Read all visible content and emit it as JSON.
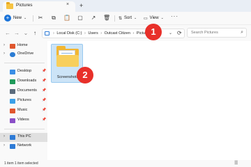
{
  "window": {
    "tab_title": "Pictures",
    "tab_close": "×",
    "new_tab": "+"
  },
  "toolbar": {
    "new_label": "New",
    "new_plus": "+",
    "sort_label": "Sort",
    "view_label": "View",
    "more_label": "···",
    "chevron": "⌄",
    "icons": {
      "cut": "✂",
      "copy": "⧉",
      "paste": "📋",
      "rename": "▢",
      "share": "↗",
      "delete": "🗑",
      "sort": "⇅",
      "view": "▭"
    }
  },
  "navigation": {
    "back": "←",
    "forward": "→",
    "recent": "⌄",
    "up": "↑"
  },
  "address": {
    "crumbs": [
      "Local Disk (C:)",
      "Users",
      "Outcast Citizen",
      "Pictures"
    ],
    "separator": "›",
    "dropdown": "⌄",
    "refresh": "⟳"
  },
  "search": {
    "placeholder": "Search Pictures",
    "icon": "⌕"
  },
  "sidebar": {
    "items": [
      {
        "label": "Home",
        "icon": "home-icon",
        "color": "#e0572e"
      },
      {
        "label": "OneDrive",
        "icon": "onedrive-icon",
        "color": "#2b7cd3"
      },
      {
        "label": "Desktop",
        "icon": "desktop-icon",
        "color": "#3a8ee6"
      },
      {
        "label": "Downloads",
        "icon": "downloads-icon",
        "color": "#1f9a5a"
      },
      {
        "label": "Documents",
        "icon": "documents-icon",
        "color": "#5a6b7c"
      },
      {
        "label": "Pictures",
        "icon": "pictures-icon",
        "color": "#3aa0e8"
      },
      {
        "label": "Music",
        "icon": "music-icon",
        "color": "#e0562e"
      },
      {
        "label": "Videos",
        "icon": "videos-icon",
        "color": "#8a4fc7"
      },
      {
        "label": "This PC",
        "icon": "this-pc-icon",
        "color": "#2e7bd6"
      },
      {
        "label": "Network",
        "icon": "network-icon",
        "color": "#2e7bd6"
      }
    ],
    "pin": "📌",
    "chevron": "›"
  },
  "main": {
    "folders": [
      {
        "label": "Screenshots"
      }
    ]
  },
  "annotations": {
    "badge1": "1",
    "badge2": "2"
  },
  "status": {
    "text": "1 item   1 item selected",
    "view_icon": "☰"
  }
}
